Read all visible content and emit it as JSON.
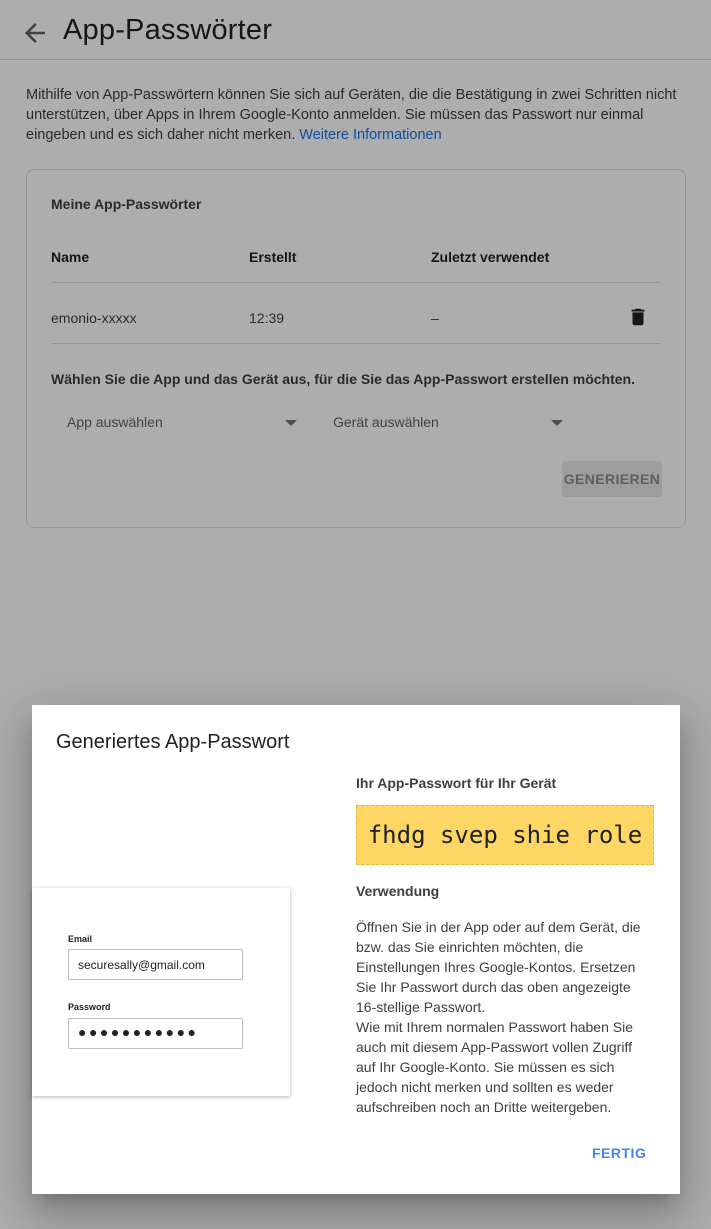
{
  "header": {
    "back_icon": "arrow-back-icon",
    "title": "App-Passwörter"
  },
  "intro": {
    "text": "Mithilfe von App-Passwörtern können Sie sich auf Geräten, die die Bestätigung in zwei Schritten nicht unterstützen, über Apps in Ihrem Google-Konto anmelden. Sie müssen das Passwort nur einmal eingeben und es sich daher nicht merken. ",
    "link": "Weitere Informationen"
  },
  "card": {
    "title": "Meine App-Passwörter",
    "columns": [
      "Name",
      "Erstellt",
      "Zuletzt verwendet"
    ],
    "rows": [
      {
        "name": "emonio-xxxxx",
        "created": "12:39",
        "last_used": "–",
        "delete_icon": "trash-icon"
      }
    ],
    "prompt": "Wählen Sie die App und das Gerät aus, für die Sie das App-Passwort erstellen möchten.",
    "app_select": "App auswählen",
    "device_select": "Gerät auswählen",
    "generate_button": "GENERIEREN"
  },
  "dialog": {
    "title": "Generiertes App-Passwort",
    "illustration": {
      "email_label": "Email",
      "email_value": "securesally@gmail.com",
      "password_label": "Password",
      "password_value": "●●●●●●●●●●●"
    },
    "password_heading": "Ihr App-Passwort für Ihr Gerät",
    "password": "fhdg svep shie role",
    "usage_heading": "Verwendung",
    "usage_p1": "Öffnen Sie in der App oder auf dem Gerät, die bzw. das Sie einrichten möchten, die Einstellungen Ihres Google-Kontos. Ersetzen Sie Ihr Passwort durch das oben angezeigte 16-stellige Passwort.",
    "usage_p2": "Wie mit Ihrem normalen Passwort haben Sie auch mit diesem App-Passwort vollen Zugriff auf Ihr Google-Konto. Sie müssen es sich jedoch nicht merken und sollten es weder aufschreiben noch an Dritte weitergeben.",
    "done_button": "FERTIG"
  },
  "colors": {
    "accent": "#4285f4",
    "link": "#1a73e8",
    "password_bg": "#fdd663"
  }
}
